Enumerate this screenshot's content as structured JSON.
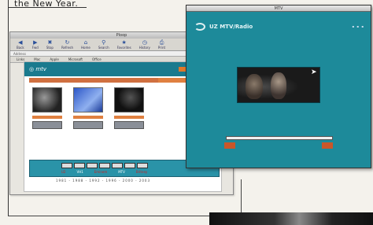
{
  "caption_top": "the New Year.",
  "browser": {
    "title": "Ploop",
    "toolbar": [
      {
        "label": "Back",
        "icon": "back-arrow-icon"
      },
      {
        "label": "Fwd",
        "icon": "forward-arrow-icon"
      },
      {
        "label": "Stop",
        "icon": "stop-icon"
      },
      {
        "label": "Refresh",
        "icon": "refresh-icon"
      },
      {
        "label": "Home",
        "icon": "home-icon"
      },
      {
        "label": "Search",
        "icon": "search-icon"
      },
      {
        "label": "Favorites",
        "icon": "favorites-icon"
      },
      {
        "label": "History",
        "icon": "history-icon"
      },
      {
        "label": "Print",
        "icon": "print-icon"
      }
    ],
    "address": "Address",
    "links": [
      "Links",
      "Mac",
      "Apple",
      "Microsoft",
      "Office"
    ],
    "page": {
      "timeline_labels": [
        "U2",
        "VH1",
        "Eminem",
        "MTV",
        "Britney"
      ],
      "ticks": "1981 - 1988 - 1992 - 1996 - 2000 - 2003"
    }
  },
  "player": {
    "title": "MTV",
    "brand": "UZ MTV/Radio"
  },
  "progress": 1.0,
  "accent": "#1d8a9a",
  "orange": "#e0782a"
}
